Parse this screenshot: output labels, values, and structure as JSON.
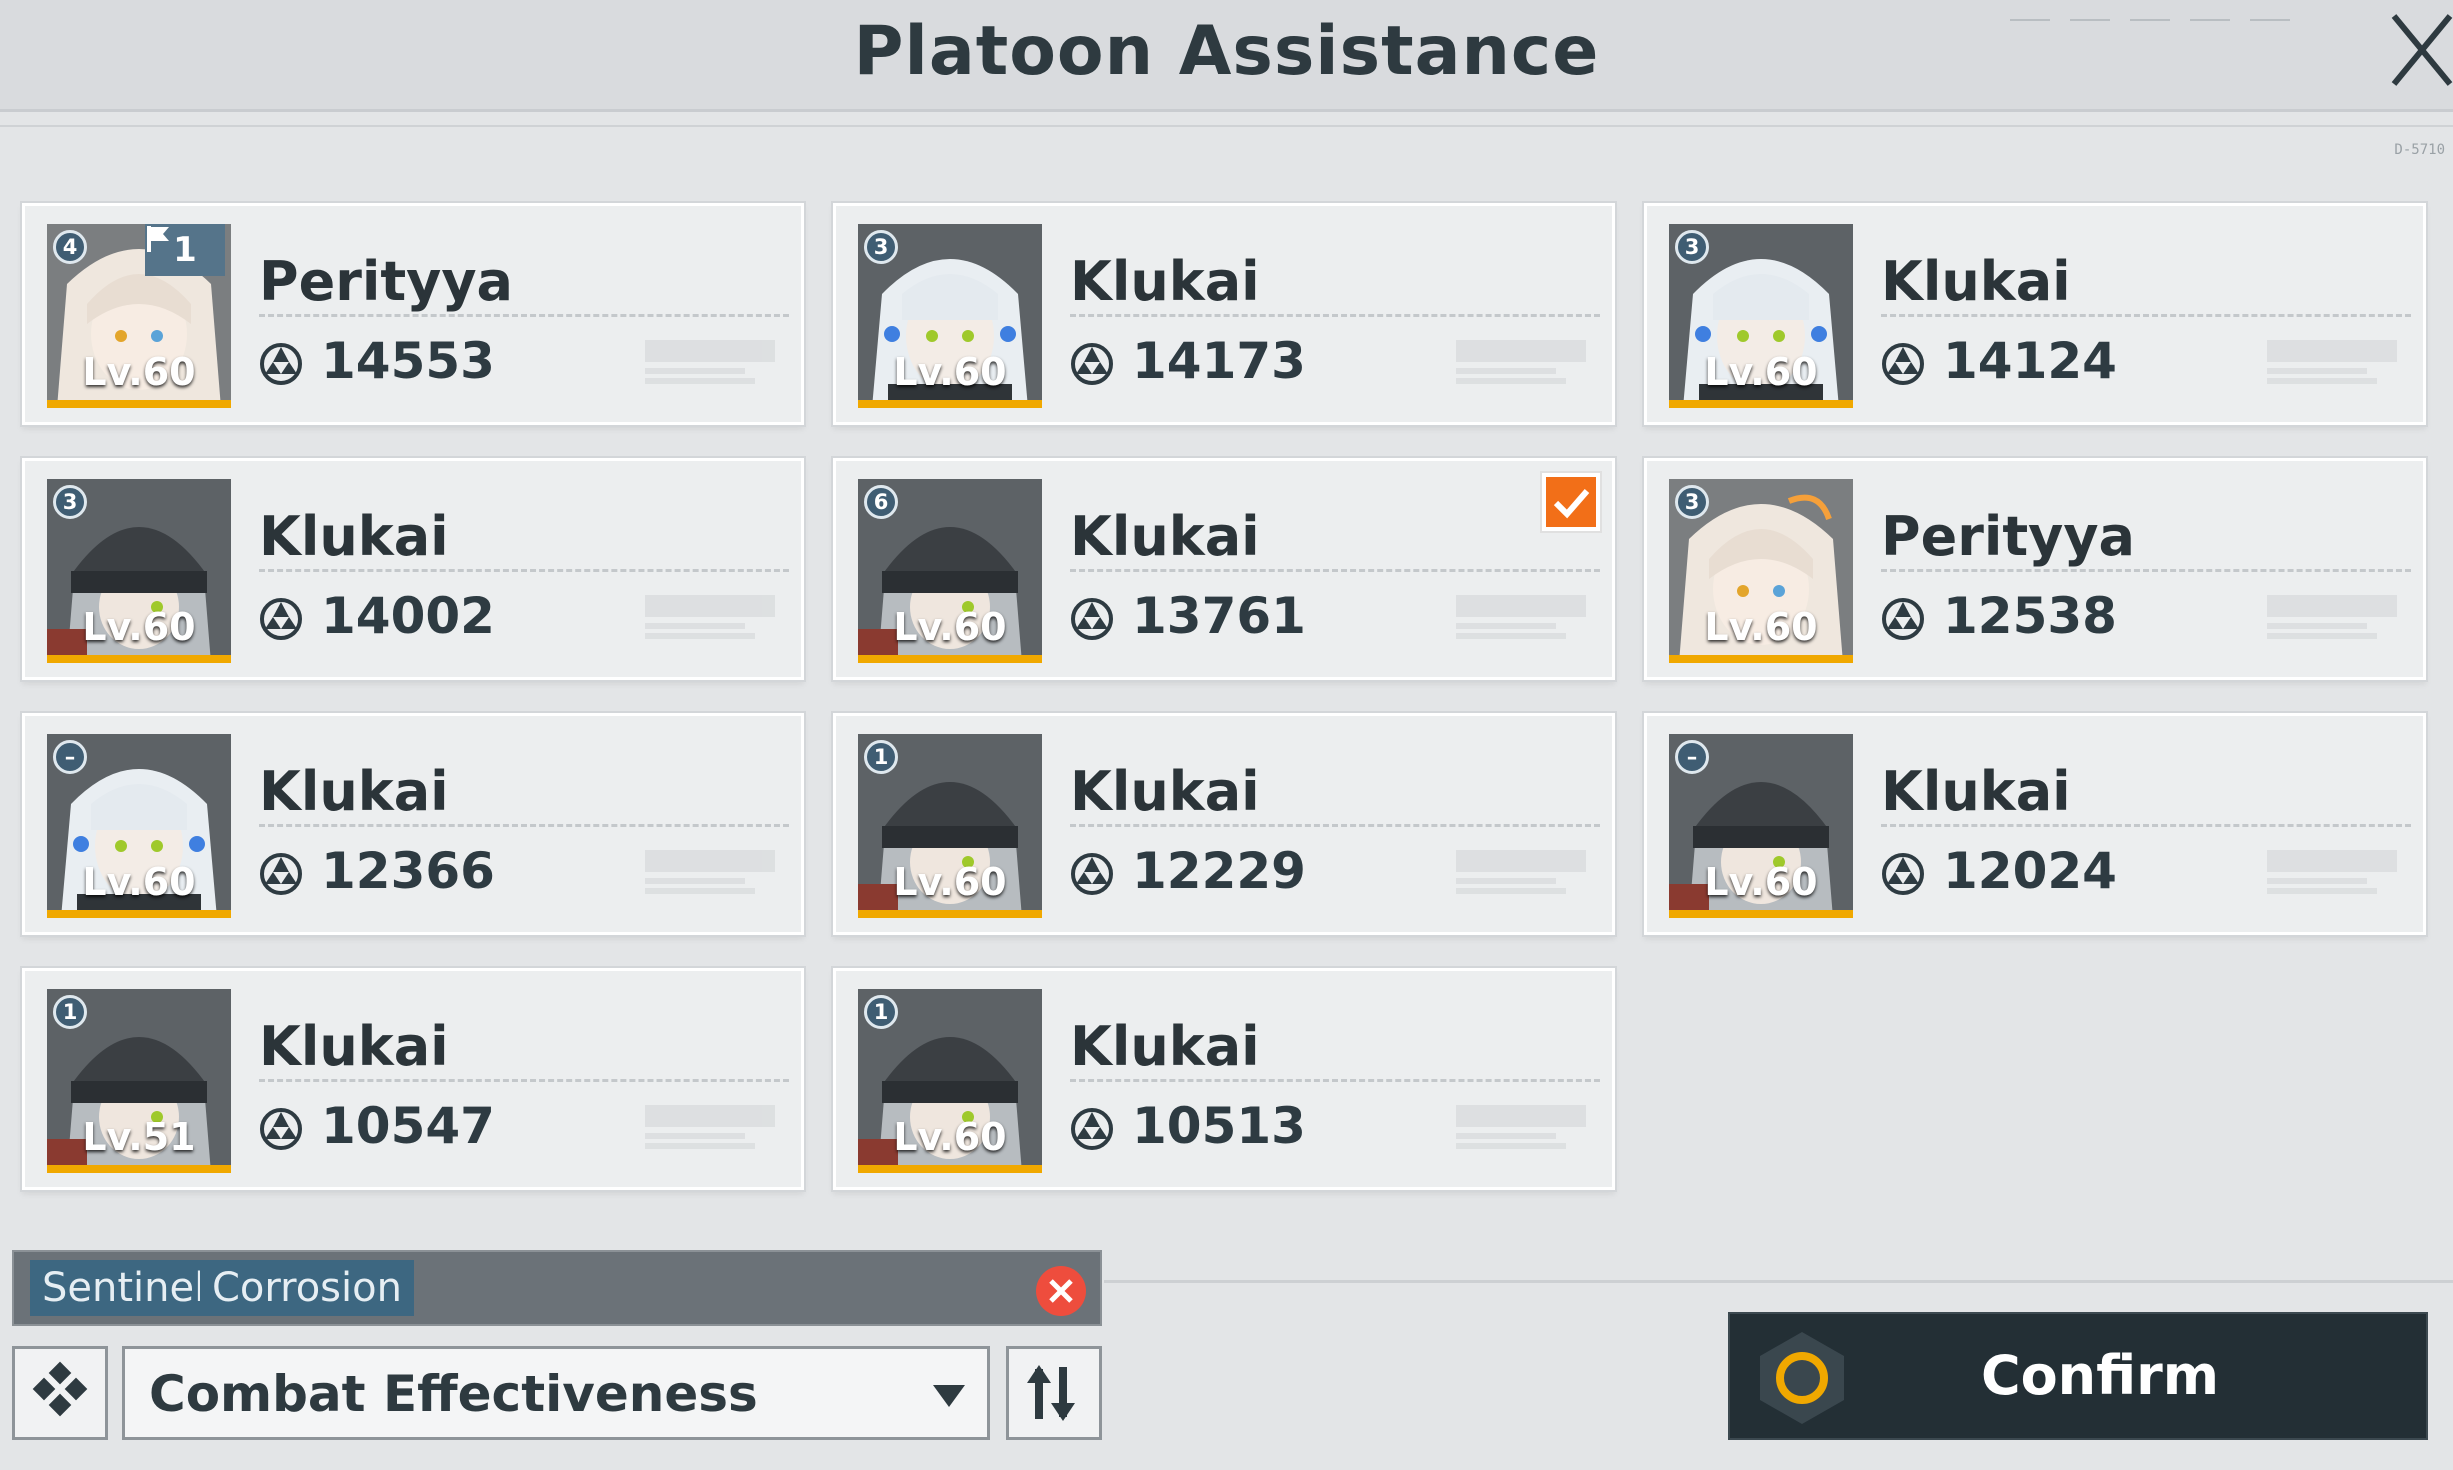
{
  "header": {
    "title": "Platoon Assistance"
  },
  "cards": [
    {
      "name": "Perityya",
      "power": "14553",
      "level": "Lv.60",
      "rank": "4",
      "flag": "1",
      "selected": false,
      "avatar": "perityya"
    },
    {
      "name": "Klukai",
      "power": "14173",
      "level": "Lv.60",
      "rank": "3",
      "flag": "",
      "selected": false,
      "avatar": "klukai"
    },
    {
      "name": "Klukai",
      "power": "14124",
      "level": "Lv.60",
      "rank": "3",
      "flag": "",
      "selected": false,
      "avatar": "klukai"
    },
    {
      "name": "Klukai",
      "power": "14002",
      "level": "Lv.60",
      "rank": "3",
      "flag": "",
      "selected": false,
      "avatar": "klukai-hat"
    },
    {
      "name": "Klukai",
      "power": "13761",
      "level": "Lv.60",
      "rank": "6",
      "flag": "",
      "selected": true,
      "avatar": "klukai-hat"
    },
    {
      "name": "Perityya",
      "power": "12538",
      "level": "Lv.60",
      "rank": "3",
      "flag": "",
      "selected": false,
      "avatar": "perityya"
    },
    {
      "name": "Klukai",
      "power": "12366",
      "level": "Lv.60",
      "rank": "–",
      "flag": "",
      "selected": false,
      "avatar": "klukai"
    },
    {
      "name": "Klukai",
      "power": "12229",
      "level": "Lv.60",
      "rank": "1",
      "flag": "",
      "selected": false,
      "avatar": "klukai-hat"
    },
    {
      "name": "Klukai",
      "power": "12024",
      "level": "Lv.60",
      "rank": "–",
      "flag": "",
      "selected": false,
      "avatar": "klukai-hat"
    },
    {
      "name": "Klukai",
      "power": "10547",
      "level": "Lv.51",
      "rank": "1",
      "flag": "",
      "selected": false,
      "avatar": "klukai-hat"
    },
    {
      "name": "Klukai",
      "power": "10513",
      "level": "Lv.60",
      "rank": "1",
      "flag": "",
      "selected": false,
      "avatar": "klukai-hat"
    }
  ],
  "filters": {
    "tags": [
      "Sentinel",
      "Corrosion"
    ]
  },
  "sort": {
    "selected": "Combat Effectiveness"
  },
  "confirm": {
    "label": "Confirm"
  },
  "deco": {
    "code": "D-5710"
  },
  "colors": {
    "accent": "#f26f18",
    "level_bar": "#f0a800",
    "confirm_bg": "#232f35",
    "confirm_ring": "#f0a800"
  },
  "icons": {
    "close": "close-icon",
    "power": "combat-power-icon",
    "sort_type": "diamond-grid-icon",
    "sort_order": "sort-order-icon",
    "clear": "clear-filter-icon",
    "check": "checkmark-icon"
  }
}
